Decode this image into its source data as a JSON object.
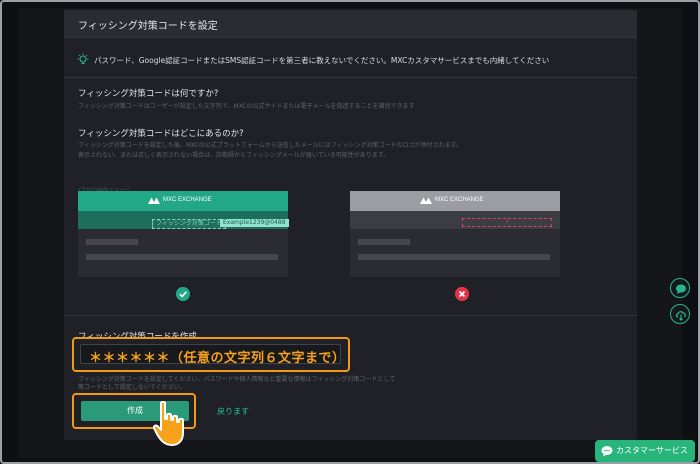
{
  "modal": {
    "title": "フィッシング対策コードを設定",
    "notice": "パスワード、Google認証コードまたはSMS認証コードを第三者に教えないでください。MXCカスタマサービスまでも内緒してください"
  },
  "what": {
    "heading": "フィッシング対策コードは何ですか?",
    "text": "フィッシング対策コードはユーザーが設定した文字列で、MXCの公式サイトまたは電子メールを偽造することを識別できます"
  },
  "where": {
    "heading": "フィッシング対策コードはどこにあるのか?",
    "text_line1": "フィッシング対策コードを設定した後、MXCの公式プラットフォームから送信したメールにはフィッシング対策コードのロゴが添付されます。",
    "text_line2": "表示されない、または正しく表示されない場合は、詐欺師からフィッシングメールが届いている可能性があります。"
  },
  "example_note": "*下記の画像イメージ",
  "cards": {
    "logo_text": "MXC EXCHANGE",
    "good_code_label": "フィッシング対策コード",
    "good_code_value": "Example1239@0488",
    "bad_code_value": "?"
  },
  "create": {
    "heading": "フィッシング対策コードを作成",
    "input_value": "＊＊＊＊＊＊（任意の文字列６文字まで）",
    "hint_line1": "フィッシング対策コードを設定してください。パスワードや個人情報など重要な情報はフィッシング対策コードとして",
    "hint_line2": "策コードとして設定しないでください。",
    "submit_label": "作成",
    "back_label": "戻ります"
  },
  "customer_service": {
    "label": "カスタマーサービス"
  },
  "colors": {
    "accent": "#22a787",
    "highlight": "#f39a12",
    "error": "#e0344b"
  },
  "icons": [
    "lightbulb-icon",
    "mxc-logo-icon",
    "check-icon",
    "close-icon",
    "chat-icon",
    "cloud-download-icon",
    "pointer-cursor-icon"
  ]
}
